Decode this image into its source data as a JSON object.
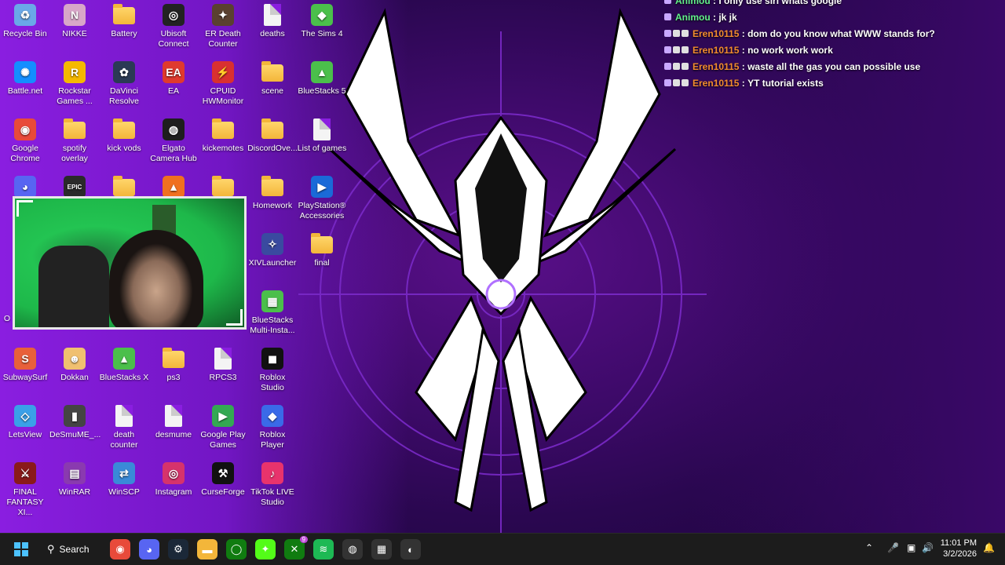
{
  "desktop": {
    "icons": [
      {
        "label": "Recycle Bin",
        "glyph": "♻",
        "color": "#6aa8e8"
      },
      {
        "label": "NIKKE",
        "glyph": "N",
        "color": "#d8a6c8"
      },
      {
        "label": "Battery",
        "glyph": "",
        "color": "folder"
      },
      {
        "label": "Ubisoft Connect",
        "glyph": "◎",
        "color": "#222"
      },
      {
        "label": "ER Death Counter",
        "glyph": "✦",
        "color": "#5a4030"
      },
      {
        "label": "deaths",
        "glyph": "",
        "color": "doc"
      },
      {
        "label": "The Sims 4",
        "glyph": "◆",
        "color": "#4bbf4b"
      },
      {
        "label": "Battle.net",
        "glyph": "✺",
        "color": "#148eff"
      },
      {
        "label": "Rockstar Games ...",
        "glyph": "R",
        "color": "#f5b800"
      },
      {
        "label": "DaVinci Resolve",
        "glyph": "✿",
        "color": "#2b3a55"
      },
      {
        "label": "EA",
        "glyph": "EA",
        "color": "#e03a2e"
      },
      {
        "label": "CPUID HWMonitor",
        "glyph": "⚡",
        "color": "#d93030"
      },
      {
        "label": "scene",
        "glyph": "",
        "color": "folder"
      },
      {
        "label": "BlueStacks 5",
        "glyph": "▲",
        "color": "#4bbf4b"
      },
      {
        "label": "Google Chrome",
        "glyph": "◉",
        "color": "#e84a3a"
      },
      {
        "label": "spotify overlay",
        "glyph": "",
        "color": "folder"
      },
      {
        "label": "kick vods",
        "glyph": "",
        "color": "folder"
      },
      {
        "label": "Elgato Camera Hub",
        "glyph": "◍",
        "color": "#1e1e1e"
      },
      {
        "label": "kickemotes",
        "glyph": "",
        "color": "folder"
      },
      {
        "label": "DiscordOve...",
        "glyph": "",
        "color": "folder"
      },
      {
        "label": "List of games",
        "glyph": "",
        "color": "doc"
      },
      {
        "label": "",
        "glyph": "◕",
        "color": "#5865f2"
      },
      {
        "label": "",
        "glyph": "EPIC",
        "color": "#2a2a2a"
      },
      {
        "label": "",
        "glyph": "",
        "color": "folder"
      },
      {
        "label": "",
        "glyph": "▲",
        "color": "#f07020"
      },
      {
        "label": "",
        "glyph": "",
        "color": "folder"
      },
      {
        "label": "Homework",
        "glyph": "",
        "color": "folder"
      },
      {
        "label": "PlayStation® Accessories",
        "glyph": "▶",
        "color": "#1a6ad8"
      },
      {
        "label": "XIVLauncher",
        "glyph": "✧",
        "color": "#3a4aa0"
      },
      {
        "label": "final",
        "glyph": "",
        "color": "folder"
      },
      {
        "label": "BlueStacks Multi-Insta...",
        "glyph": "▦",
        "color": "#4bbf4b"
      },
      {
        "label": "SubwaySurf",
        "glyph": "S",
        "color": "#e8603a"
      },
      {
        "label": "Dokkan",
        "glyph": "☻",
        "color": "#f0c070"
      },
      {
        "label": "BlueStacks X",
        "glyph": "▲",
        "color": "#4bbf4b"
      },
      {
        "label": "ps3",
        "glyph": "",
        "color": "folder"
      },
      {
        "label": "RPCS3",
        "glyph": "",
        "color": "doc"
      },
      {
        "label": "Roblox Studio",
        "glyph": "◼",
        "color": "#111"
      },
      {
        "label": "LetsView",
        "glyph": "◇",
        "color": "#3aa0e8"
      },
      {
        "label": "DeSmuME_...",
        "glyph": "▮",
        "color": "#444"
      },
      {
        "label": "death counter",
        "glyph": "",
        "color": "doc"
      },
      {
        "label": "desmume",
        "glyph": "",
        "color": "doc"
      },
      {
        "label": "Google Play Games",
        "glyph": "▶",
        "color": "#34a853"
      },
      {
        "label": "Roblox Player",
        "glyph": "◆",
        "color": "#3a6ae8"
      },
      {
        "label": "FINAL FANTASY XI...",
        "glyph": "⚔",
        "color": "#8a1a1a"
      },
      {
        "label": "WinRAR",
        "glyph": "▤",
        "color": "#8a3ab0"
      },
      {
        "label": "WinSCP",
        "glyph": "⇄",
        "color": "#3a8ad8"
      },
      {
        "label": "Instagram",
        "glyph": "◎",
        "color": "#d6336c"
      },
      {
        "label": "CurseForge",
        "glyph": "⚒",
        "color": "#111"
      },
      {
        "label": "TikTok LIVE Studio",
        "glyph": "♪",
        "color": "#e8336c"
      }
    ],
    "partial_label": "O"
  },
  "chat": {
    "messages": [
      {
        "user": "Animou",
        "text": "I only use siri whats google",
        "color": "green",
        "badges": 1
      },
      {
        "user": "Animou",
        "text": "jk jk",
        "color": "green",
        "badges": 1
      },
      {
        "user": "Eren10115",
        "text": "dom do you know what WWW stands for?",
        "color": "orange",
        "badges": 3
      },
      {
        "user": "Eren10115",
        "text": "no work work work",
        "color": "orange",
        "badges": 3
      },
      {
        "user": "Eren10115",
        "text": "waste all the gas you can possible use",
        "color": "orange",
        "badges": 3
      },
      {
        "user": "Eren10115",
        "text": "YT tutorial exists",
        "color": "orange",
        "badges": 3
      }
    ]
  },
  "taskbar": {
    "search_label": "Search",
    "apps": [
      {
        "name": "chrome",
        "glyph": "◉",
        "color": "#e84a3a"
      },
      {
        "name": "discord",
        "glyph": "◕",
        "color": "#5865f2"
      },
      {
        "name": "steam",
        "glyph": "⚙",
        "color": "#1b2838"
      },
      {
        "name": "file-explorer",
        "glyph": "▬",
        "color": "#f3b63a"
      },
      {
        "name": "xbox-app",
        "glyph": "◯",
        "color": "#107c10"
      },
      {
        "name": "kick",
        "glyph": "✦",
        "color": "#53fc18"
      },
      {
        "name": "xbox-game-bar",
        "glyph": "✕",
        "color": "#107c10"
      },
      {
        "name": "spotify",
        "glyph": "≋",
        "color": "#1db954"
      },
      {
        "name": "camera-hub",
        "glyph": "◍",
        "color": "#333"
      },
      {
        "name": "stream-deck",
        "glyph": "▦",
        "color": "#333"
      },
      {
        "name": "obs",
        "glyph": "◐",
        "color": "#333"
      }
    ],
    "xbox_badge": "9",
    "clock_time": "11:01 PM",
    "clock_date": "3/2/2026"
  }
}
